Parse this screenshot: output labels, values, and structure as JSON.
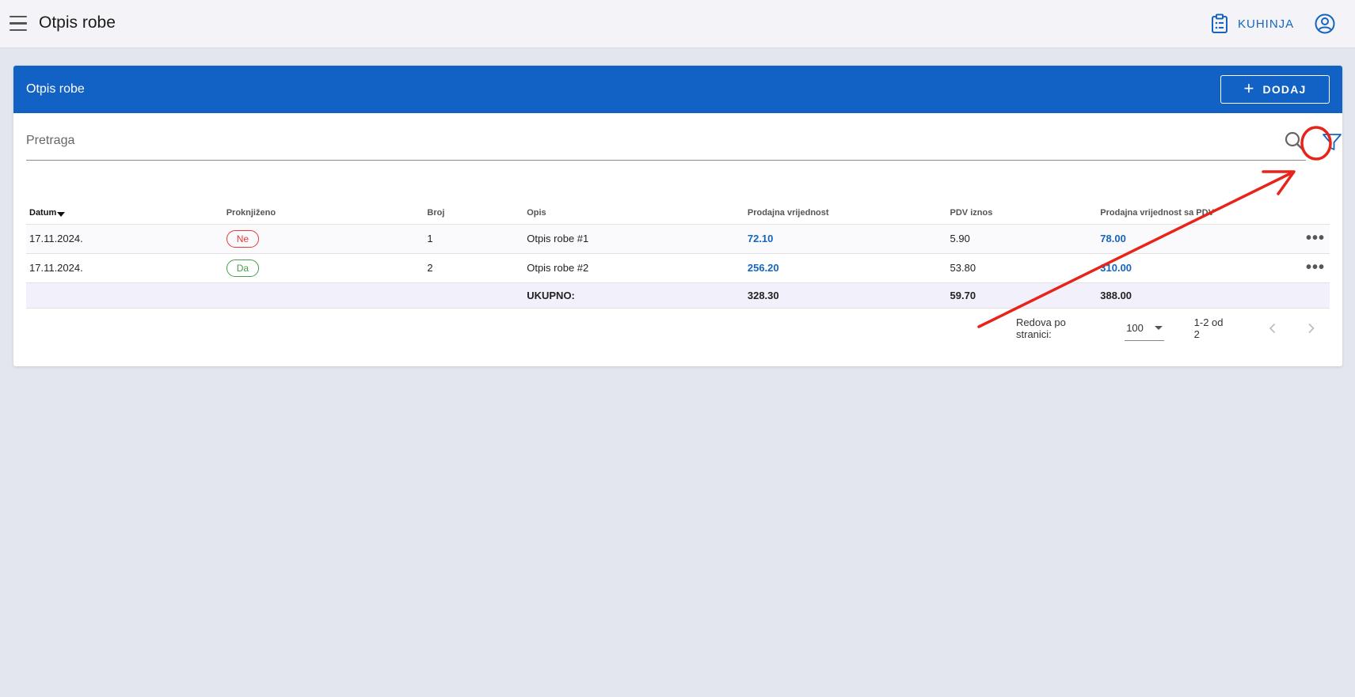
{
  "appbar": {
    "title": "Otpis robe",
    "kuhinja_label": "KUHINJA"
  },
  "card": {
    "title": "Otpis robe",
    "add_label": "DODAJ"
  },
  "search": {
    "placeholder": "Pretraga",
    "value": ""
  },
  "table": {
    "columns": [
      "Datum",
      "Proknjiženo",
      "Broj",
      "Opis",
      "Prodajna vrijednost",
      "PDV iznos",
      "Prodajna vrijednost sa PDV"
    ],
    "rows": [
      {
        "datum": "17.11.2024.",
        "proknjizeno": "Ne",
        "broj": "1",
        "opis": "Otpis robe #1",
        "prodajna": "72.10",
        "pdv": "5.90",
        "sa_pdv": "78.00"
      },
      {
        "datum": "17.11.2024.",
        "proknjizeno": "Da",
        "broj": "2",
        "opis": "Otpis robe #2",
        "prodajna": "256.20",
        "pdv": "53.80",
        "sa_pdv": "310.00"
      }
    ],
    "total": {
      "label": "UKUPNO:",
      "prodajna": "328.30",
      "pdv": "59.70",
      "sa_pdv": "388.00"
    }
  },
  "pagination": {
    "rows_label": "Redova po stranici:",
    "rows_value": "100",
    "range": "1-2 od 2"
  },
  "colors": {
    "primary": "#1262c6",
    "annotation": "#e8231a",
    "badge_no": "#e53935",
    "badge_yes": "#43a047"
  },
  "icons": [
    "menu-icon",
    "clipboard-icon",
    "account-circle-icon",
    "plus-icon",
    "search-icon",
    "filter-icon",
    "more-icon",
    "chevron-left-icon",
    "chevron-right-icon",
    "sort-desc-icon"
  ]
}
